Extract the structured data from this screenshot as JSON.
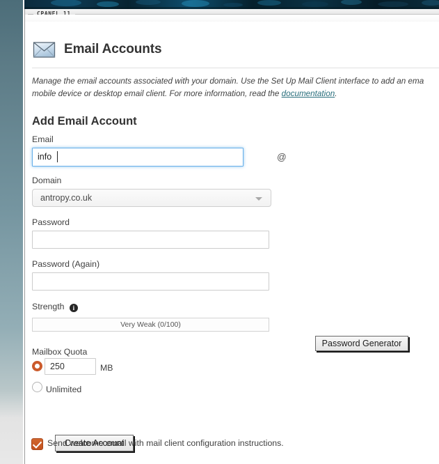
{
  "window": {
    "tab_label": "CPANEL 11"
  },
  "header": {
    "icon": "envelope-icon",
    "title": "Email Accounts"
  },
  "description": {
    "line1": "Manage the email accounts associated with your domain. Use the Set Up Mail Client interface to add an ema",
    "line2_before_link": "mobile device or desktop email client. For more information, read the ",
    "link_text": "documentation",
    "line2_after_link": "."
  },
  "form": {
    "section_heading": "Add Email Account",
    "email": {
      "label": "Email",
      "value": "info",
      "at_symbol": "@"
    },
    "domain": {
      "label": "Domain",
      "selected": "antropy.co.uk",
      "options": [
        "antropy.co.uk"
      ]
    },
    "password": {
      "label": "Password",
      "value": ""
    },
    "password_again": {
      "label": "Password (Again)",
      "value": ""
    },
    "strength": {
      "label": "Strength",
      "info_icon": "info-icon",
      "meter_text": "Very Weak (0/100)",
      "score": 0,
      "max_score": 100,
      "generator_button": "Password Generator"
    },
    "quota": {
      "label": "Mailbox Quota",
      "selected_option": "fixed",
      "value": "250",
      "unit": "MB",
      "unlimited_label": "Unlimited"
    },
    "submit_button": "Create Account",
    "welcome_email": {
      "checked": true,
      "label": "Send welcome email with mail client configuration instructions."
    }
  },
  "colors": {
    "accent": "#cb5a2b",
    "link": "#2a6f7d",
    "focus_ring": "#66afe9",
    "rail_top": "#4c6d79",
    "banner": "#06202e"
  }
}
